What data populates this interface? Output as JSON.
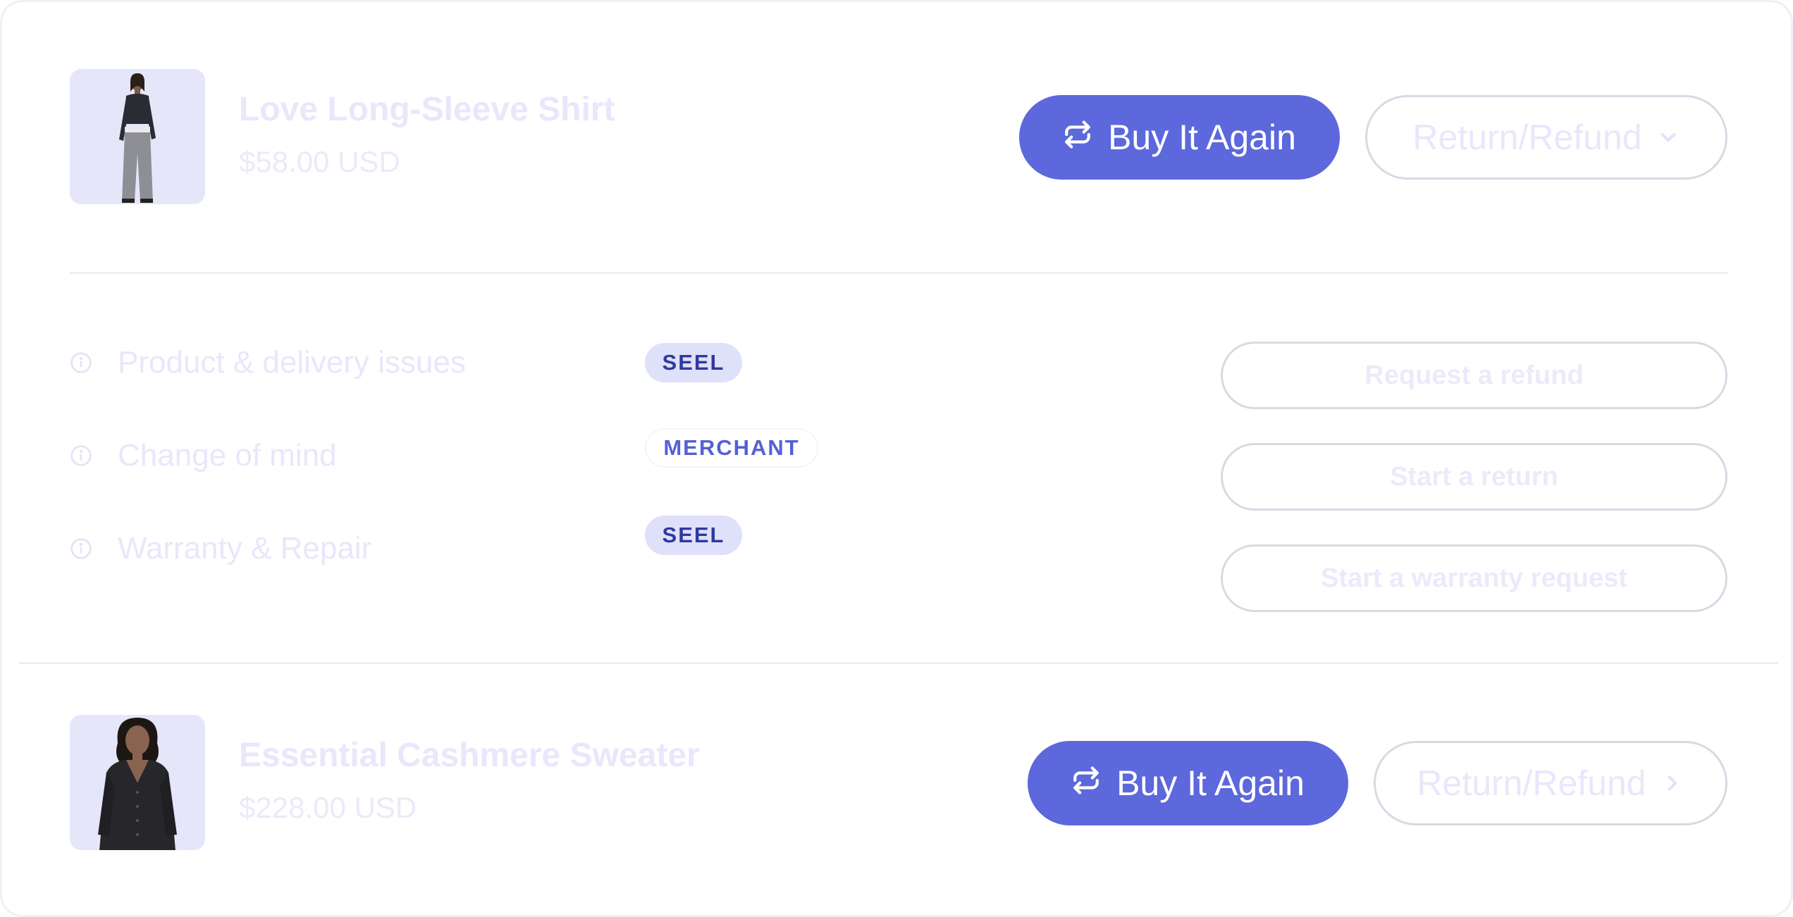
{
  "products": [
    {
      "name": "Love Long-Sleeve Shirt",
      "price": "$58.00 USD",
      "buy_again_label": "Buy It Again",
      "buy_again_icon": "repeat-icon",
      "return_label": "Return/Refund",
      "return_icon": "chevron-down-icon",
      "thumbnail": "woman in black crop top and grey sweatpants"
    },
    {
      "name": "Essential Cashmere Sweater",
      "price": "$228.00 USD",
      "buy_again_label": "Buy It Again",
      "buy_again_icon": "repeat-icon",
      "return_label": "Return/Refund",
      "return_icon": "chevron-right-icon",
      "thumbnail": "woman in black cashmere cardigan"
    }
  ],
  "issues": [
    {
      "label": "Product & delivery issues",
      "badge": "SEEL",
      "icon": "info-icon"
    },
    {
      "label": "Change of mind",
      "badge": "MERCHANT",
      "icon": "info-icon"
    },
    {
      "label": "Warranty & Repair",
      "badge": "SEEL",
      "icon": "info-icon"
    }
  ],
  "actions": [
    {
      "label": "Request a refund"
    },
    {
      "label": "Start a return"
    },
    {
      "label": "Start a warranty request"
    }
  ],
  "colors": {
    "primary": "#5c68db",
    "badge_bg": "#dfe0f9",
    "badge_text": "#2f3a9e",
    "faded_text": "#e8e7fb",
    "border": "#d9d9e4",
    "thumb_bg": "#e6e6fb"
  }
}
